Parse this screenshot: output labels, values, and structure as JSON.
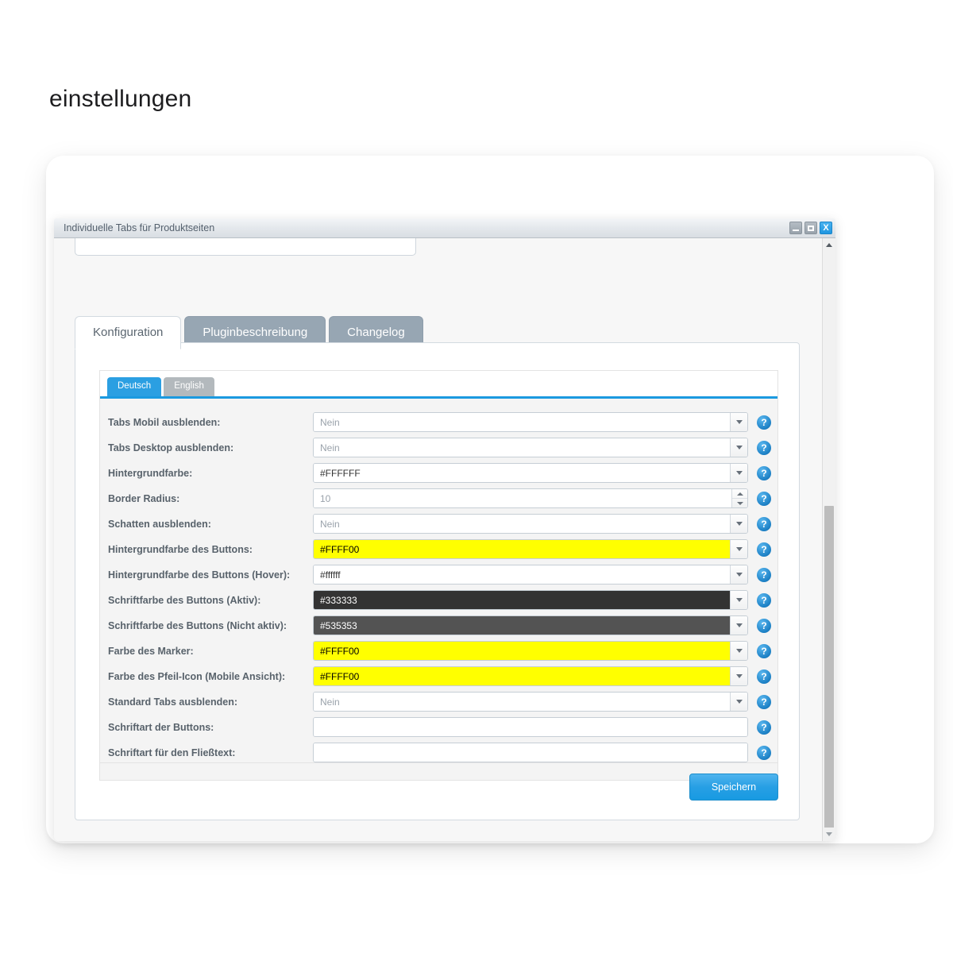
{
  "page": {
    "title": "einstellungen"
  },
  "window": {
    "title": "Individuelle Tabs für Produktseiten",
    "controls": {
      "minimize": "minimize-icon",
      "maximize": "maximize-icon",
      "close": "X"
    }
  },
  "tabs": [
    {
      "label": "Konfiguration",
      "active": true
    },
    {
      "label": "Pluginbeschreibung",
      "active": false
    },
    {
      "label": "Changelog",
      "active": false
    }
  ],
  "language_tabs": [
    {
      "label": "Deutsch",
      "active": true
    },
    {
      "label": "English",
      "active": false
    }
  ],
  "form": {
    "rows": [
      {
        "label": "Tabs Mobil ausblenden:",
        "value": "Nein",
        "control": "dropdown",
        "value_style": "placeholder",
        "bg": "#ffffff",
        "fg": "#9aa2ab"
      },
      {
        "label": "Tabs Desktop ausblenden:",
        "value": "Nein",
        "control": "dropdown",
        "value_style": "placeholder",
        "bg": "#ffffff",
        "fg": "#9aa2ab"
      },
      {
        "label": "Hintergrundfarbe:",
        "value": "#FFFFFF",
        "control": "dropdown",
        "value_style": "normal",
        "bg": "#ffffff",
        "fg": "#333333"
      },
      {
        "label": "Border Radius:",
        "value": "10",
        "control": "spinner",
        "value_style": "placeholder",
        "bg": "#ffffff",
        "fg": "#9aa2ab"
      },
      {
        "label": "Schatten ausblenden:",
        "value": "Nein",
        "control": "dropdown",
        "value_style": "placeholder",
        "bg": "#ffffff",
        "fg": "#9aa2ab"
      },
      {
        "label": "Hintergrundfarbe des Buttons:",
        "value": "#FFFF00",
        "control": "dropdown",
        "value_style": "normal",
        "bg": "#ffff00",
        "fg": "#000000"
      },
      {
        "label": "Hintergrundfarbe des Buttons (Hover):",
        "value": "#ffffff",
        "control": "dropdown",
        "value_style": "normal",
        "bg": "#ffffff",
        "fg": "#333333"
      },
      {
        "label": "Schriftfarbe des Buttons (Aktiv):",
        "value": "#333333",
        "control": "dropdown",
        "value_style": "normal",
        "bg": "#333333",
        "fg": "#ffffff"
      },
      {
        "label": "Schriftfarbe des Buttons (Nicht aktiv):",
        "value": "#535353",
        "control": "dropdown",
        "value_style": "normal",
        "bg": "#535353",
        "fg": "#ffffff"
      },
      {
        "label": "Farbe des Marker:",
        "value": "#FFFF00",
        "control": "dropdown",
        "value_style": "normal",
        "bg": "#ffff00",
        "fg": "#000000"
      },
      {
        "label": "Farbe des Pfeil-Icon (Mobile Ansicht):",
        "value": "#FFFF00",
        "control": "dropdown",
        "value_style": "normal",
        "bg": "#ffff00",
        "fg": "#000000"
      },
      {
        "label": "Standard Tabs ausblenden:",
        "value": "Nein",
        "control": "dropdown",
        "value_style": "placeholder",
        "bg": "#ffffff",
        "fg": "#9aa2ab"
      },
      {
        "label": "Schriftart der Buttons:",
        "value": "",
        "control": "text",
        "value_style": "normal",
        "bg": "#ffffff",
        "fg": "#333333"
      },
      {
        "label": "Schriftart für den Fließtext:",
        "value": "",
        "control": "text",
        "value_style": "normal",
        "bg": "#ffffff",
        "fg": "#333333"
      }
    ],
    "help_icon_label": "?"
  },
  "actions": {
    "save_label": "Speichern"
  },
  "colors": {
    "accent": "#1b9ae0",
    "tab_inactive": "#97a6b3",
    "highlight_yellow": "#ffff00",
    "save_button": "#279fe4"
  }
}
